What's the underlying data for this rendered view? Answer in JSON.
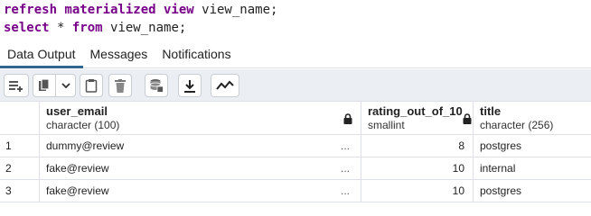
{
  "editor": {
    "line1": {
      "kw": "refresh materialized view",
      "rest": " view_name;"
    },
    "line2": {
      "kw1": "select",
      "mid": " * ",
      "kw2": "from",
      "rest": " view_name;"
    }
  },
  "tabs": [
    {
      "label": "Data Output",
      "active": true
    },
    {
      "label": "Messages",
      "active": false
    },
    {
      "label": "Notifications",
      "active": false
    }
  ],
  "toolbar": {
    "icons": [
      "add-row-icon",
      "copy-icon",
      "chevron-down-icon",
      "paste-icon",
      "delete-icon",
      "save-data-icon",
      "download-icon",
      "graph-icon"
    ]
  },
  "grid": {
    "columns": [
      {
        "name": "user_email",
        "type": "character (100)",
        "locked": true
      },
      {
        "name": "rating_out_of_10",
        "type": "smallint",
        "locked": true
      },
      {
        "name": "title",
        "type": "character (256)",
        "locked": false
      }
    ],
    "rows": [
      {
        "num": "1",
        "user_email": "dummy@review",
        "ellipsis": "...",
        "rating_out_of_10": "8",
        "title": "postgres"
      },
      {
        "num": "2",
        "user_email": "fake@review",
        "ellipsis": "...",
        "rating_out_of_10": "10",
        "title": "internal"
      },
      {
        "num": "3",
        "user_email": "fake@review",
        "ellipsis": "...",
        "rating_out_of_10": "10",
        "title": "postgres"
      }
    ]
  },
  "colors": {
    "accent": "#326690",
    "keyword": "#770088",
    "toolbar_bg": "#ebeef3",
    "border": "#dde0e6"
  }
}
